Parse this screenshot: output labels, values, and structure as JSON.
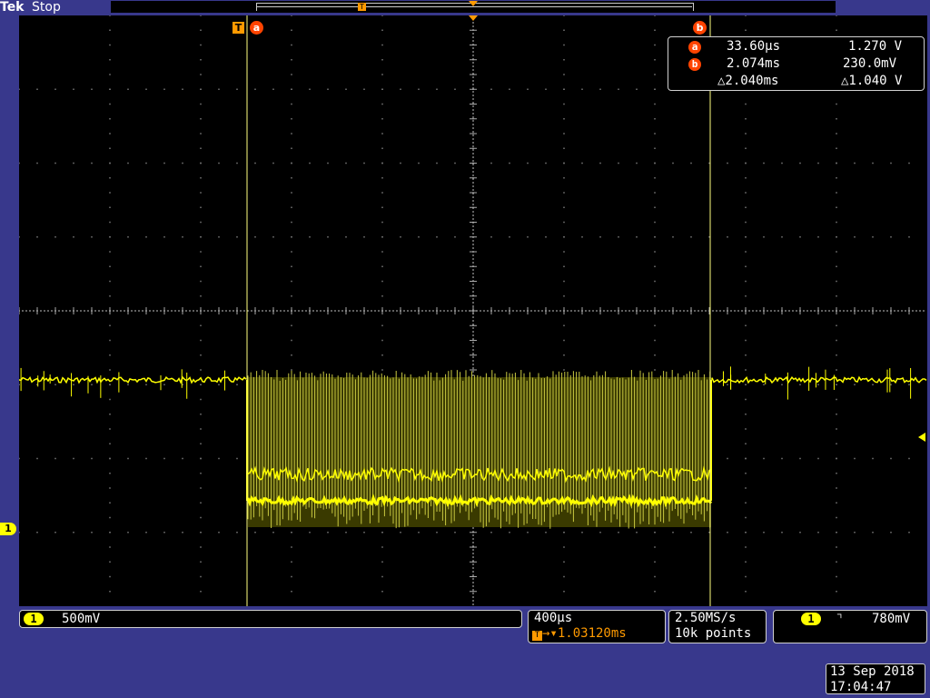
{
  "header": {
    "brand": "Tek",
    "status": "Stop"
  },
  "channel": {
    "number": "1",
    "scale": "500mV",
    "color": "#ffff00"
  },
  "horizontal": {
    "time_per_div": "400µs",
    "trigger_position": "1.03120ms"
  },
  "acquisition": {
    "sample_rate": "2.50MS/s",
    "record_length": "10k points"
  },
  "trigger": {
    "source": "1",
    "slope_icon": "falling-edge-icon",
    "level": "780mV"
  },
  "cursors": {
    "a": {
      "label": "a",
      "time": "33.60µs",
      "value": "1.270 V"
    },
    "b": {
      "label": "b",
      "time": "2.074ms",
      "value": "230.0mV"
    },
    "delta": {
      "time": "△2.040ms",
      "value": "△1.040 V"
    }
  },
  "datetime": {
    "date": "13 Sep 2018",
    "time": "17:04:47"
  },
  "markers": {
    "trigger": "T",
    "cursor_a": "a",
    "cursor_b": "b",
    "channel": "1"
  }
}
